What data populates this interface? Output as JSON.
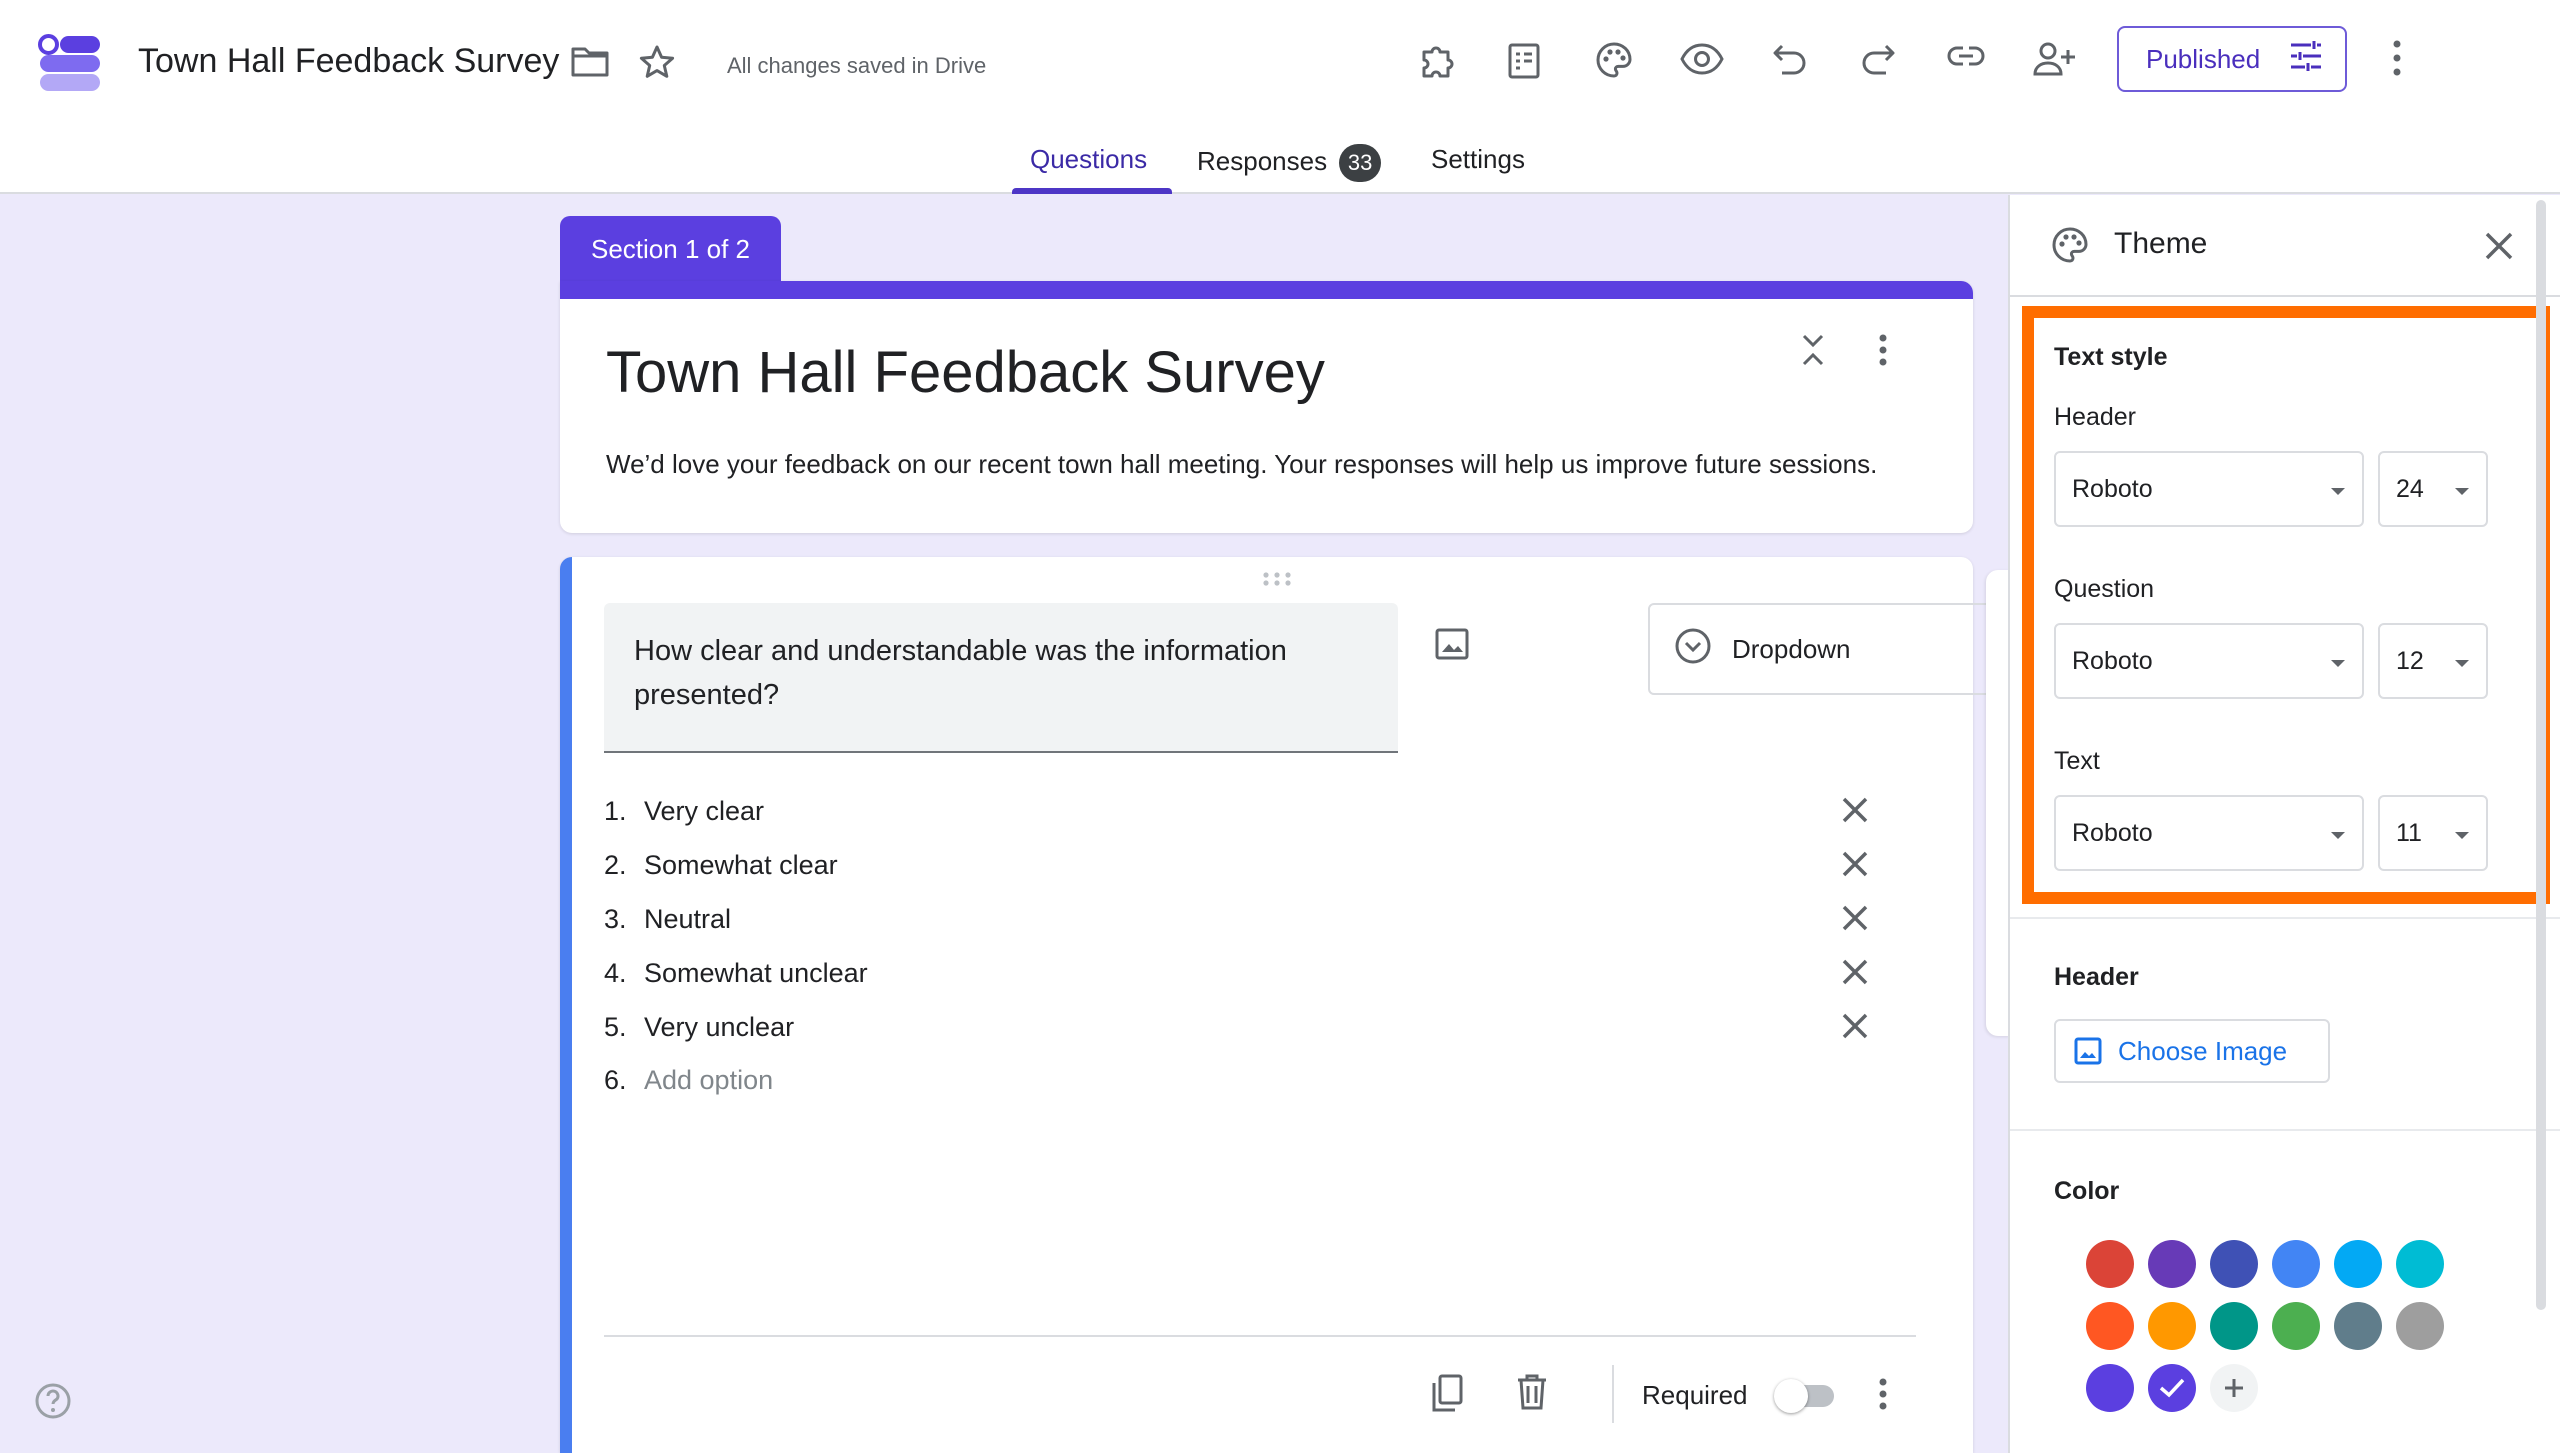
{
  "app": {
    "doc_title": "Town Hall Feedback Survey",
    "save_status": "All changes saved in Drive",
    "publish_label": "Published"
  },
  "tabs": [
    {
      "label": "Questions"
    },
    {
      "label": "Responses",
      "count": "33"
    },
    {
      "label": "Settings"
    }
  ],
  "form": {
    "section_label": "Section 1 of 2",
    "title": "Town Hall Feedback Survey",
    "description": "We’d love your feedback on our recent town hall meeting. Your responses will help us improve future sessions."
  },
  "question": {
    "text": "How clear and understandable was the information presented?",
    "type": "Dropdown",
    "options": [
      {
        "num": "1.",
        "label": "Very clear"
      },
      {
        "num": "2.",
        "label": "Somewhat clear"
      },
      {
        "num": "3.",
        "label": "Neutral"
      },
      {
        "num": "4.",
        "label": "Somewhat unclear"
      },
      {
        "num": "5.",
        "label": "Very unclear"
      }
    ],
    "add_option": {
      "num": "6.",
      "label": "Add option"
    },
    "required_label": "Required",
    "required": false
  },
  "theme": {
    "title": "Theme",
    "text_style": {
      "title": "Text style",
      "header": {
        "label": "Header",
        "font": "Roboto",
        "size": "24"
      },
      "question": {
        "label": "Question",
        "font": "Roboto",
        "size": "12"
      },
      "text": {
        "label": "Text",
        "font": "Roboto",
        "size": "11"
      }
    },
    "header_section": {
      "title": "Header",
      "choose_image": "Choose Image"
    },
    "color_section": {
      "title": "Color",
      "swatches": [
        "#db4437",
        "#673ab7",
        "#3f51b5",
        "#4285f4",
        "#03a9f4",
        "#00bcd4",
        "#ff5722",
        "#ff9800",
        "#009688",
        "#4caf50",
        "#607d8b",
        "#9e9e9e",
        "#5b3fe0",
        "#5b3fe0"
      ],
      "selected_index": 13
    }
  },
  "colors": {
    "accent": "#5b3fe0",
    "question_bar": "#4a7ef0",
    "highlight": "#ff6d00",
    "background": "#ece9fb"
  }
}
